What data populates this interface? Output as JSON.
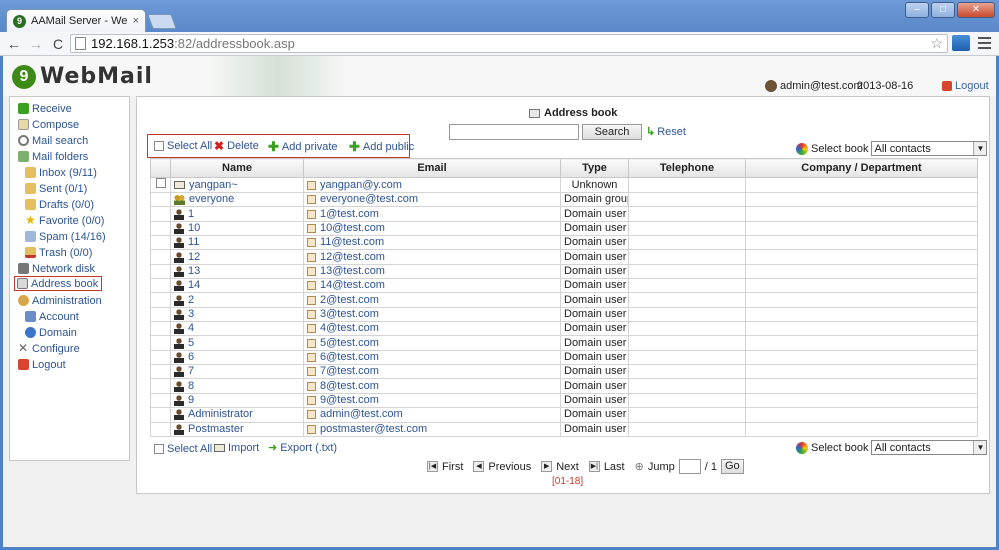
{
  "browser": {
    "tab_title": "AAMail Server - Webm",
    "tab_close": "×",
    "url_host": "192.168.1.253",
    "url_path": ":82/addressbook.asp"
  },
  "header": {
    "logo": "WebMail",
    "user": "admin@test.com",
    "date": "2013-08-16",
    "logout": "Logout"
  },
  "sidebar": {
    "items": [
      {
        "label": "Receive",
        "icon": "receive-icon"
      },
      {
        "label": "Compose",
        "icon": "compose-icon"
      },
      {
        "label": "Mail search",
        "icon": "search-icon"
      },
      {
        "label": "Mail folders",
        "icon": "folders-icon"
      },
      {
        "label": "Inbox (9/11)",
        "icon": "inbox-icon"
      },
      {
        "label": "Sent (0/1)",
        "icon": "sent-icon"
      },
      {
        "label": "Drafts (0/0)",
        "icon": "drafts-icon"
      },
      {
        "label": "Favorite (0/0)",
        "icon": "star-icon"
      },
      {
        "label": "Spam (14/16)",
        "icon": "spam-icon"
      },
      {
        "label": "Trash (0/0)",
        "icon": "trash-icon"
      },
      {
        "label": "Network disk",
        "icon": "disk-icon"
      },
      {
        "label": "Address book",
        "icon": "addressbook-icon"
      },
      {
        "label": "Administration",
        "icon": "admin-icon"
      },
      {
        "label": "Account",
        "icon": "account-icon"
      },
      {
        "label": "Domain",
        "icon": "domain-icon"
      },
      {
        "label": "Configure",
        "icon": "configure-icon"
      },
      {
        "label": "Logout",
        "icon": "logout-icon"
      }
    ]
  },
  "main": {
    "title": "Address book",
    "search_button": "Search",
    "reset": "Reset",
    "actions": {
      "select_all": "Select All",
      "delete": "Delete",
      "add_private": "Add private",
      "add_public": "Add public"
    },
    "select_book_label": "Select book",
    "select_book_value": "All contacts",
    "columns": [
      "Name",
      "Email",
      "Type",
      "Telephone",
      "Company / Department"
    ],
    "rows": [
      {
        "name": "yangpan~",
        "email": "yangpan@y.com",
        "type": "Unknown",
        "tel": "",
        "company": ""
      },
      {
        "name": "everyone",
        "email": "everyone@test.com",
        "type": "Domain group",
        "tel": "",
        "company": ""
      },
      {
        "name": "1",
        "email": "1@test.com",
        "type": "Domain user",
        "tel": "",
        "company": ""
      },
      {
        "name": "10",
        "email": "10@test.com",
        "type": "Domain user",
        "tel": "",
        "company": ""
      },
      {
        "name": "11",
        "email": "11@test.com",
        "type": "Domain user",
        "tel": "",
        "company": ""
      },
      {
        "name": "12",
        "email": "12@test.com",
        "type": "Domain user",
        "tel": "",
        "company": ""
      },
      {
        "name": "13",
        "email": "13@test.com",
        "type": "Domain user",
        "tel": "",
        "company": ""
      },
      {
        "name": "14",
        "email": "14@test.com",
        "type": "Domain user",
        "tel": "",
        "company": ""
      },
      {
        "name": "2",
        "email": "2@test.com",
        "type": "Domain user",
        "tel": "",
        "company": ""
      },
      {
        "name": "3",
        "email": "3@test.com",
        "type": "Domain user",
        "tel": "",
        "company": ""
      },
      {
        "name": "4",
        "email": "4@test.com",
        "type": "Domain user",
        "tel": "",
        "company": ""
      },
      {
        "name": "5",
        "email": "5@test.com",
        "type": "Domain user",
        "tel": "",
        "company": ""
      },
      {
        "name": "6",
        "email": "6@test.com",
        "type": "Domain user",
        "tel": "",
        "company": ""
      },
      {
        "name": "7",
        "email": "7@test.com",
        "type": "Domain user",
        "tel": "",
        "company": ""
      },
      {
        "name": "8",
        "email": "8@test.com",
        "type": "Domain user",
        "tel": "",
        "company": ""
      },
      {
        "name": "9",
        "email": "9@test.com",
        "type": "Domain user",
        "tel": "",
        "company": ""
      },
      {
        "name": "Administrator",
        "email": "admin@test.com",
        "type": "Domain user",
        "tel": "",
        "company": ""
      },
      {
        "name": "Postmaster",
        "email": "postmaster@test.com",
        "type": "Domain user",
        "tel": "",
        "company": ""
      }
    ],
    "bottom": {
      "select_all": "Select All",
      "import": "Import",
      "export": "Export (.txt)"
    },
    "pager": {
      "first": "First",
      "previous": "Previous",
      "next": "Next",
      "last": "Last",
      "jump": "Jump",
      "total": "/ 1",
      "go": "Go",
      "range": "[01-18]"
    }
  }
}
